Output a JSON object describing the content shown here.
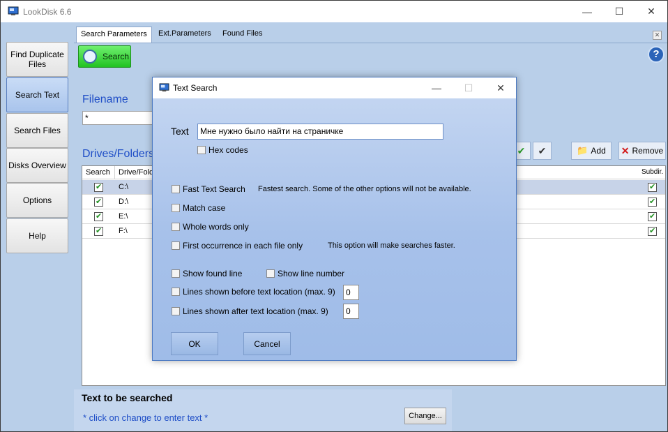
{
  "window": {
    "title": "LookDisk 6.6"
  },
  "sidebar": {
    "items": [
      {
        "label": "Find Duplicate Files"
      },
      {
        "label": "Search Text"
      },
      {
        "label": "Search Files"
      },
      {
        "label": "Disks Overview"
      },
      {
        "label": "Options"
      },
      {
        "label": "Help"
      }
    ]
  },
  "tabs": [
    "Search Parameters",
    "Ext.Parameters",
    "Found Files"
  ],
  "toolbar": {
    "search_label": "Search",
    "help_symbol": "?"
  },
  "filename": {
    "label": "Filename",
    "value": "*"
  },
  "drives": {
    "label": "Drives/Folders t",
    "add_label": "Add",
    "remove_label": "Remove",
    "columns": [
      "Search",
      "Drive/Folde",
      "Subdir."
    ],
    "rows": [
      {
        "drive": "C:\\",
        "search": true,
        "subdir": true
      },
      {
        "drive": "D:\\",
        "search": true,
        "subdir": true
      },
      {
        "drive": "E:\\",
        "search": true,
        "subdir": true
      },
      {
        "drive": "F:\\",
        "search": true,
        "subdir": true
      }
    ]
  },
  "text_to_search": {
    "title": "Text to be searched",
    "hint": "* click on change to enter text *",
    "change_label": "Change..."
  },
  "dialog": {
    "title": "Text Search",
    "text_label": "Text",
    "text_value": "Мне нужно было найти на страничке",
    "hex_codes": "Hex codes",
    "fast_text_search": "Fast Text Search",
    "fast_text_hint": "Fastest search. Some of the other options will not be available.",
    "match_case": "Match case",
    "whole_words": "Whole words only",
    "first_occurrence": "First occurrence in each file only",
    "first_occurrence_hint": "This option will make searches faster.",
    "show_found_line": "Show found line",
    "show_line_number": "Show line number",
    "lines_before": "Lines shown before text location (max. 9)",
    "lines_before_value": "0",
    "lines_after": "Lines shown after text location (max. 9)",
    "lines_after_value": "0",
    "ok_label": "OK",
    "cancel_label": "Cancel"
  }
}
